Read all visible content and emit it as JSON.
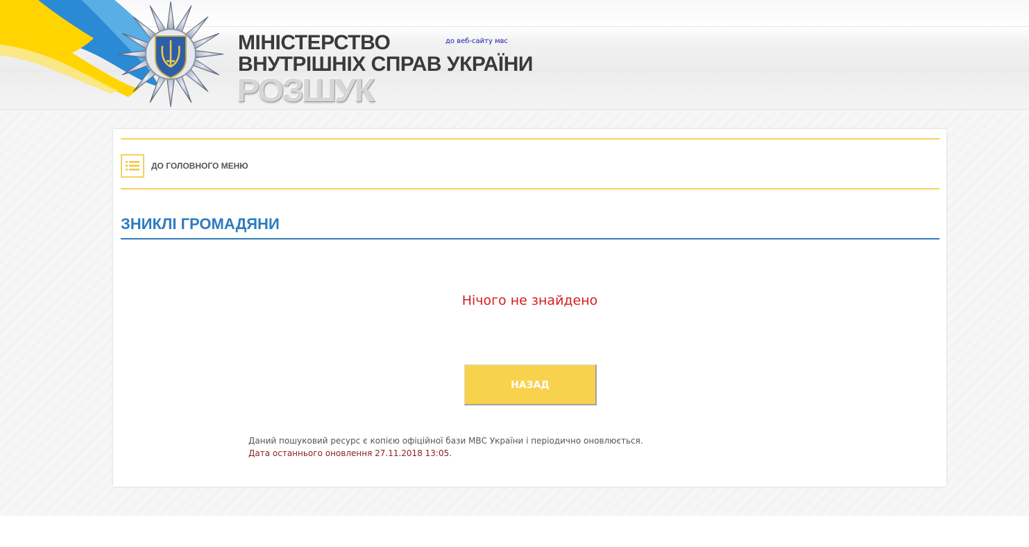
{
  "header": {
    "ministry_line1": "МІНІСТЕРСТВО",
    "ministry_line2": "ВНУТРІШНІХ СПРАВ УКРАЇНИ",
    "search_word": "РОЗШУК",
    "mvs_link": "до веб-сайту мвс"
  },
  "nav": {
    "main_menu_label": "ДО ГОЛОВНОГО МЕНЮ",
    "main_menu_icon": "list-icon"
  },
  "section": {
    "title": "ЗНИКЛІ ГРОМАДЯНИ"
  },
  "results": {
    "empty_message": "Нічого не знайдено"
  },
  "actions": {
    "back_label": "НАЗАД"
  },
  "footer_note": {
    "line1": "Даний пошуковий ресурс є копією офіційної бази МВС України і періодично оновлюється.",
    "line2": "Дата останнього оновлення 27.11.2018 13:05."
  },
  "colors": {
    "accent_yellow": "#f5d15a",
    "title_blue": "#2f7bbf",
    "error_red": "#d51e1e",
    "flag_blue": "#2a8ad4",
    "flag_yellow": "#ffd700"
  }
}
